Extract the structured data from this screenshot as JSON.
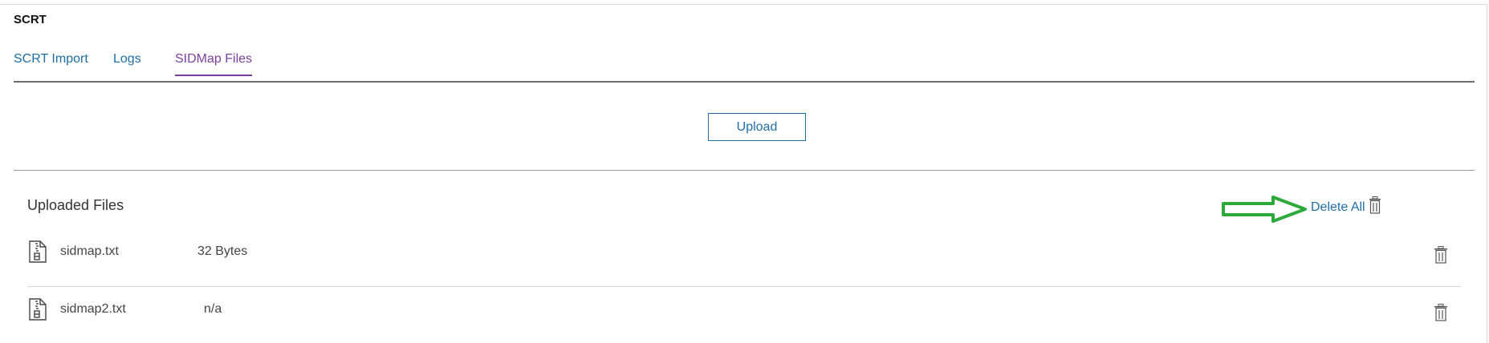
{
  "app": {
    "title": "SCRT"
  },
  "tabs": [
    {
      "label": "SCRT Import",
      "active": false
    },
    {
      "label": "Logs",
      "active": false
    },
    {
      "label": "SIDMap Files",
      "active": true
    }
  ],
  "upload": {
    "label": "Upload"
  },
  "files": {
    "heading": "Uploaded Files",
    "delete_all_label": "Delete All",
    "rows": [
      {
        "name": "sidmap.txt",
        "size": "32 Bytes"
      },
      {
        "name": "sidmap2.txt",
        "size": "n/a"
      }
    ]
  },
  "icons": {
    "file": "file-zip-icon",
    "trash": "trash-icon",
    "annotation": "arrow-right-icon"
  },
  "colors": {
    "link": "#1e6fa5",
    "active_tab": "#7b3fa0",
    "annotation_arrow": "#2eaa3c"
  }
}
